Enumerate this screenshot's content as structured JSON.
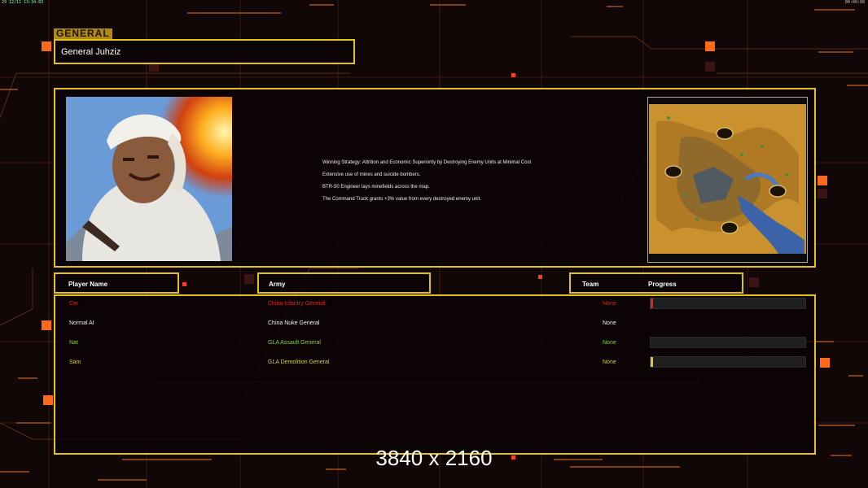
{
  "topbar": {
    "left_text": "29 12/11 13:34:83",
    "right_text": "00:00:00"
  },
  "general": {
    "section_label": "GENERAL",
    "name": "General Juhziz"
  },
  "strategy_lines": [
    "Winning Strategy: Attrition and Economic Superiority by Destroying Enemy Units at Minimal Cost",
    "Extensive use of mines and suicide bombers.",
    "BTR-50 Engineer lays minefields across the map.",
    "The Command Truck grants +3% value from every destroyed enemy unit."
  ],
  "headers": {
    "player_name": "Player Name",
    "army": "Army",
    "team": "Team",
    "progress": "Progress"
  },
  "players": [
    {
      "name": "Cer",
      "army": "China Infantry General",
      "team": "None",
      "color": "#e02020",
      "has_progress": true,
      "progress": 0.01,
      "progress_color": "#e02020"
    },
    {
      "name": "Normal AI",
      "army": "China Nuke General",
      "team": "None",
      "color": "#f0f0f0",
      "has_progress": false,
      "progress": 0,
      "progress_color": "#f0f0f0"
    },
    {
      "name": "Nat",
      "army": "GLA Assault General",
      "team": "None",
      "color": "#7fd62a",
      "has_progress": true,
      "progress": 0,
      "progress_color": "#7fd62a"
    },
    {
      "name": "Sam",
      "army": "GLA Demolition General",
      "team": "None",
      "color": "#d8cf2a",
      "has_progress": true,
      "progress": 0.015,
      "progress_color": "#d8cf2a"
    }
  ],
  "watermark": "3840 x 2160",
  "colors": {
    "frame": "#e2c21b",
    "accent": "#ff6a1a"
  }
}
